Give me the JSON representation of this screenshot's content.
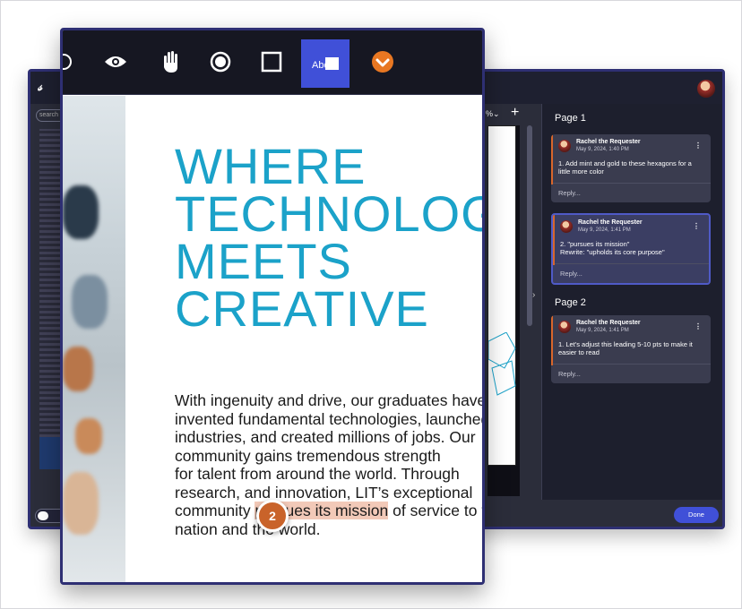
{
  "colors": {
    "accent": "#4050d8",
    "brand_blue": "#1ba2c9",
    "highlight": "#f2c9b8",
    "marker": "#c9632a",
    "comment_bar": "#d8662b"
  },
  "back_window": {
    "search_placeholder": "search",
    "zoom_label": "%⌄",
    "add_label": "+",
    "sidebar_toggle": "›",
    "comments": {
      "pages": [
        {
          "label": "Page 1",
          "comments": [
            {
              "author": "Rachel the Requester",
              "date": "May 9, 2024, 1:40 PM",
              "text": "1. Add mint and gold to these hexagons for a little more color",
              "reply": "Reply...",
              "active": false
            },
            {
              "author": "Rachel the Requester",
              "date": "May 9, 2024, 1:41 PM",
              "text": "2. \"pursues its mission\"\nRewrite: \"upholds its core purpose\"",
              "reply": "Reply...",
              "active": true
            }
          ]
        },
        {
          "label": "Page 2",
          "comments": [
            {
              "author": "Rachel the Requester",
              "date": "May 9, 2024, 1:41 PM",
              "text": "1. Let's adjust this leading 5-10 pts to make it easier to read",
              "reply": "Reply...",
              "active": false
            }
          ]
        }
      ],
      "menu_glyph": "⋮"
    },
    "done_label": "Done"
  },
  "toolbar": {
    "tools": [
      {
        "name": "partial-tool-icon",
        "active": false
      },
      {
        "name": "eye-icon",
        "active": false
      },
      {
        "name": "hand-icon",
        "active": false
      },
      {
        "name": "record-icon",
        "active": false
      },
      {
        "name": "square-icon",
        "active": false
      },
      {
        "name": "text-edit-icon",
        "active": true,
        "label": "Abc"
      },
      {
        "name": "chevron-down-circle-icon",
        "active": false
      }
    ]
  },
  "document": {
    "headline": "WHERE\nTECHNOLOGY\nMEETS\nCREATIVE",
    "body_before": "With ingenuity and drive, our graduates have\ninvented fundamental technologies, launched\nindustries, and created millions of jobs. Our\ncommunity gains tremendous strength\nfor talent from around the world. Through\nresearch, and innovation, LIT’s exceptional\ncommunity ",
    "body_highlight": "pursues its mission",
    "body_after": " of service to the\nnation and the world.",
    "marker_number": "2"
  }
}
